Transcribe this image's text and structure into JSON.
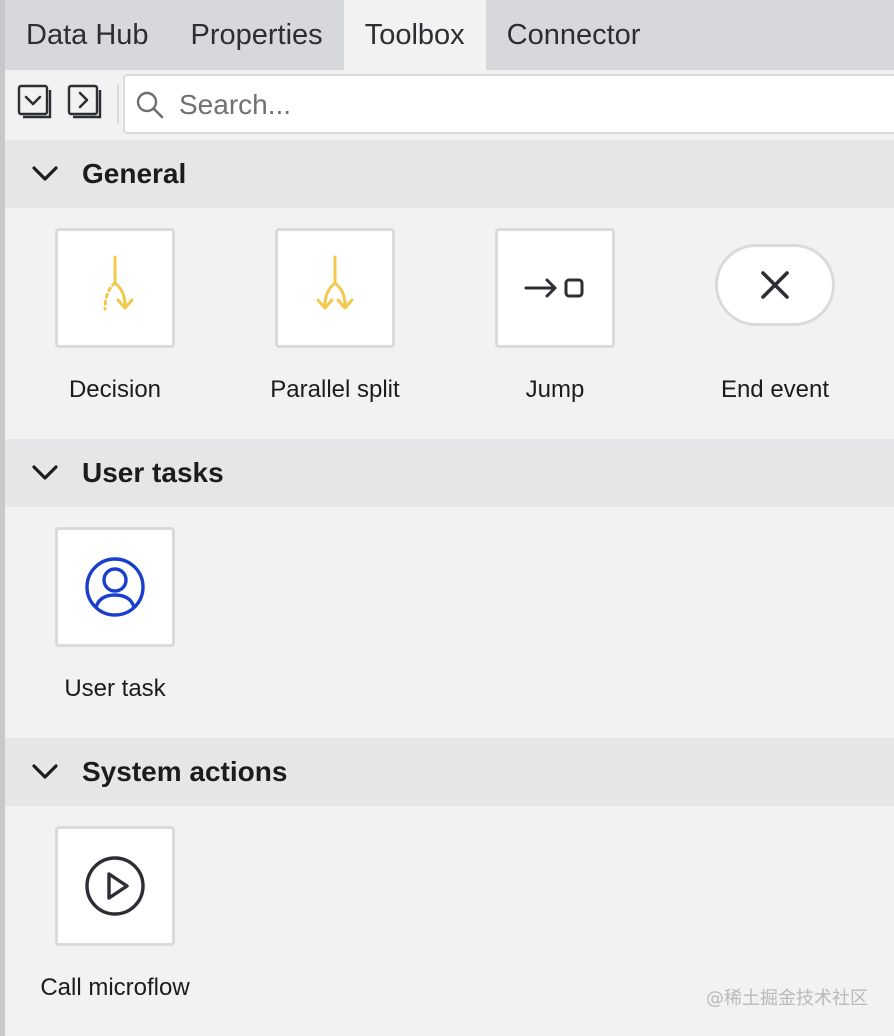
{
  "tabs": [
    {
      "label": "Data Hub",
      "active": false
    },
    {
      "label": "Properties",
      "active": false
    },
    {
      "label": "Toolbox",
      "active": true
    },
    {
      "label": "Connector",
      "active": false
    }
  ],
  "toolbar": {
    "collapse_all_icon": "collapse-all-icon",
    "expand_all_icon": "expand-all-icon",
    "search_placeholder": "Search...",
    "search_value": ""
  },
  "sections": {
    "general": {
      "title": "General",
      "items": [
        {
          "label": "Decision",
          "icon": "decision-icon"
        },
        {
          "label": "Parallel split",
          "icon": "parallel-split-icon"
        },
        {
          "label": "Jump",
          "icon": "jump-icon"
        },
        {
          "label": "End event",
          "icon": "close-icon"
        }
      ]
    },
    "user_tasks": {
      "title": "User tasks",
      "items": [
        {
          "label": "User task",
          "icon": "user-icon"
        }
      ]
    },
    "system_actions": {
      "title": "System actions",
      "items": [
        {
          "label": "Call microflow",
          "icon": "play-circle-icon"
        }
      ]
    }
  },
  "colors": {
    "flow_yellow": "#f2c94c",
    "user_blue": "#1a3fcc",
    "icon_dark": "#2d2e33"
  },
  "watermark": "@稀土掘金技术社区"
}
